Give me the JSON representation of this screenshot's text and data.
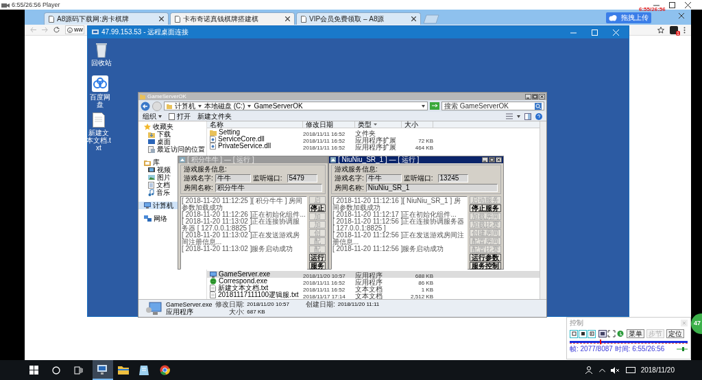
{
  "player": {
    "title": "6:55/26:56 Player"
  },
  "browser": {
    "tabs": [
      {
        "label": "A8源码下载网:房卡棋牌",
        "selected": false
      },
      {
        "label": "卡布奇诺真钱棋牌搭建棋",
        "selected": true
      },
      {
        "label": "VIP会员免费领取 – A8源",
        "selected": false
      }
    ],
    "address": "ww",
    "upload_button": "拖拽上传",
    "overlay_time": "6:55/26:56",
    "extension_badge": "1"
  },
  "remote": {
    "title": "47.99.153.53 - 远程桌面连接"
  },
  "desktop_icons": [
    {
      "kind": "recycle",
      "label": "回收站"
    },
    {
      "kind": "cloud",
      "label": "百度网盘"
    },
    {
      "kind": "text",
      "label": "新建文本文档.txt"
    }
  ],
  "explorer": {
    "title": "GameServerOK",
    "breadcrumb": [
      "计算机",
      "本地磁盘 (C:)",
      "GameServerOK"
    ],
    "search_placeholder": "搜索 GameServerOK",
    "toolbar": [
      "组织",
      "打开",
      "新建文件夹"
    ],
    "nav": [
      {
        "label": "收藏夹",
        "kind": "star",
        "selected": false,
        "children": [
          {
            "label": "下载",
            "kind": "download",
            "selected": false
          },
          {
            "label": "桌面",
            "kind": "desktop",
            "selected": false
          },
          {
            "label": "最近访问的位置",
            "kind": "recent",
            "selected": false
          }
        ]
      },
      {
        "label": "库",
        "kind": "library",
        "selected": false,
        "children": [
          {
            "label": "视频",
            "kind": "video",
            "selected": false
          },
          {
            "label": "图片",
            "kind": "picture",
            "selected": false
          },
          {
            "label": "文档",
            "kind": "doc",
            "selected": false
          },
          {
            "label": "音乐",
            "kind": "music",
            "selected": false
          }
        ]
      },
      {
        "label": "计算机",
        "kind": "computer",
        "selected": true
      },
      {
        "label": "网络",
        "kind": "network",
        "selected": false
      }
    ],
    "columns": [
      "名称",
      "修改日期",
      "类型",
      "大小"
    ],
    "rows_top": [
      {
        "kind": "folder",
        "name": "Setting",
        "date": "2018/11/11 16:52",
        "type": "文件夹",
        "selected": false
      },
      {
        "kind": "dll",
        "name": "ServiceCore.dll",
        "date": "2018/11/11 16:52",
        "type": "应用程序扩展",
        "size": "72 KB",
        "selected": false
      },
      {
        "kind": "dll",
        "name": "PrivateService.dll",
        "date": "2018/11/11 16:52",
        "type": "应用程序扩展",
        "size": "464 KB",
        "selected": false
      }
    ],
    "rows_bottom": [
      {
        "kind": "exe",
        "name": "GameServer.exe",
        "date": "2018/11/20 10:57",
        "type": "应用程序",
        "size": "688 KB",
        "selected": true
      },
      {
        "kind": "green",
        "name": "Correspond.exe",
        "date": "2018/11/11 16:52",
        "type": "应用程序",
        "size": "86 KB",
        "selected": false
      },
      {
        "kind": "text",
        "name": "新建文本文档.txt",
        "date": "2018/11/11 16:52",
        "type": "文本文档",
        "size": "1 KB",
        "selected": false
      },
      {
        "kind": "text",
        "name": "20181117111100逻辑服.txt",
        "date": "2018/11/17 17:14",
        "type": "文本文档",
        "size": "2,512 KB",
        "selected": false
      }
    ],
    "details": {
      "name": "GameServer.exe",
      "type": "应用程序",
      "modified_label": "修改日期:",
      "modified": "2018/11/20 10:57",
      "created_label": "创建日期:",
      "created": "2018/11/20 11:11",
      "size_label": "大小:",
      "size": "687 KB"
    }
  },
  "dialogs": [
    {
      "title": "[ 积分牛牛 ] — [ 运行 ]",
      "active": false,
      "group_label": "游戏服务信息:",
      "name_label": "游戏名字:",
      "name": "牛牛",
      "port_label": "监听端口:",
      "port": "5479",
      "room_label": "房间名称:",
      "room": "积分牛牛",
      "log": [
        "[ 2018-11-20 11:12:25 ][ 积分牛牛 ] 房间参数加载成功",
        "[ 2018-11-20 11:12:26 ]正在初始化组件...",
        "[ 2018-11-20 11:13:02 ]正在连接协调服务器 [ 127.0.0.1:8825 ]",
        "[ 2018-11-20 11:13:02 ]正在发送游戏房间注册信息...",
        "[ 2018-11-20 11:13:02 ]服务启动成功"
      ],
      "buttons": [
        {
          "label": "启",
          "disabled": true
        },
        {
          "label": "停止",
          "disabled": false
        },
        {
          "label": "加",
          "disabled": true
        },
        {
          "label": "加",
          "disabled": true
        },
        {
          "label": "创",
          "disabled": true
        },
        {
          "label": "配",
          "disabled": true
        },
        {
          "label": "配",
          "disabled": true
        },
        {
          "label": "运行",
          "disabled": false
        },
        {
          "label": "服务",
          "disabled": false
        }
      ]
    },
    {
      "title": "[ NiuNiu_SR_1 ] — [ 运行 ]",
      "active": true,
      "group_label": "游戏服务信息:",
      "name_label": "游戏名字:",
      "name": "牛牛",
      "port_label": "监听端口:",
      "port": "13245",
      "room_label": "房间名称:",
      "room": "NiuNiu_SR_1",
      "log": [
        "[ 2018-11-20 11:12:16 ][ NiuNiu_SR_1 ] 房间参数加载成功",
        "[ 2018-11-20 11:12:17 ]正在初始化组件...",
        "[ 2018-11-20 11:12:56 ]正在连接协调服务器 [ 127.0.0.1:8825 ]",
        "[ 2018-11-20 11:12:56 ]正在发送游戏房间注册信息...",
        "[ 2018-11-20 11:12:56 ]服务启动成功"
      ],
      "buttons": [
        {
          "label": "启动服务",
          "disabled": true
        },
        {
          "label": "停止服务",
          "disabled": false
        },
        {
          "label": "加载房间",
          "disabled": true
        },
        {
          "label": "加载比赛",
          "disabled": true
        },
        {
          "label": "创建房间",
          "disabled": true
        },
        {
          "label": "配置房间",
          "disabled": true
        },
        {
          "label": "配置比赛",
          "disabled": true
        },
        {
          "label": "运行参数",
          "disabled": false
        },
        {
          "label": "服务控制",
          "disabled": false
        }
      ]
    }
  ],
  "control_panel": {
    "title": "控制",
    "buttons": [
      {
        "label": "菜单",
        "disabled": false
      },
      {
        "label": "步节",
        "disabled": true
      },
      {
        "label": "定位",
        "disabled": false
      }
    ],
    "level": 0.257,
    "status": "帧: 2077/8087 时间: 6:55/26:56",
    "volume": {
      "level": 0.55
    }
  },
  "taskbar": {
    "apps": [
      {
        "kind": "remote",
        "selected": true
      },
      {
        "kind": "explorer",
        "selected": false
      },
      {
        "kind": "notepad",
        "selected": false
      },
      {
        "kind": "chrome",
        "selected": false
      }
    ],
    "date": "2018/11/20"
  },
  "side_badge": "47"
}
